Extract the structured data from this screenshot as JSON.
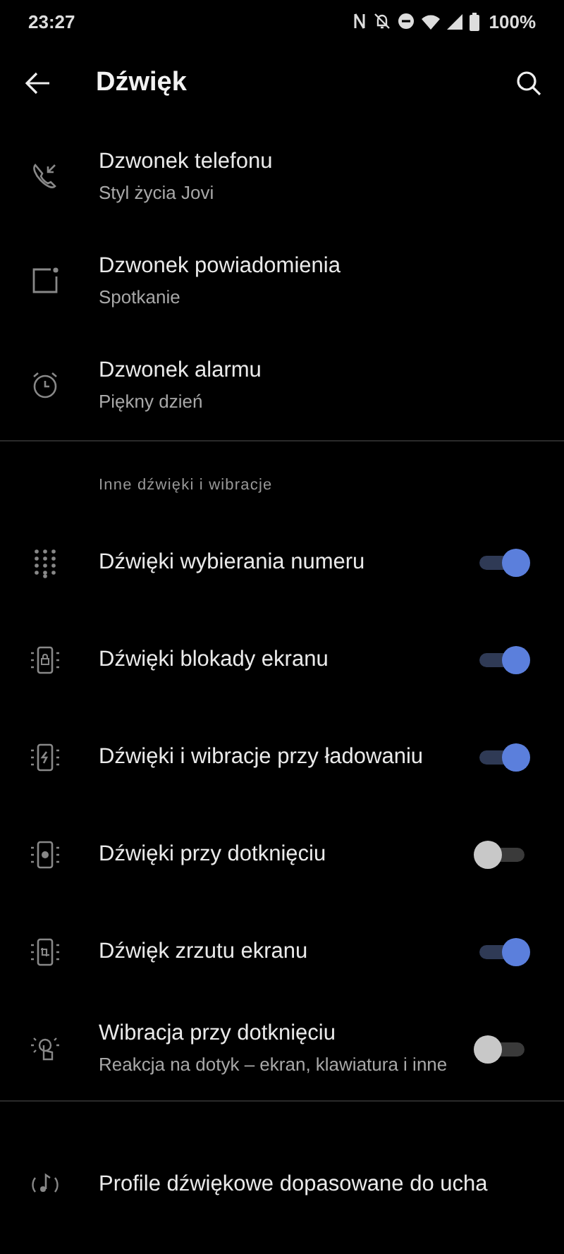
{
  "status_bar": {
    "time": "23:27",
    "battery": "100%"
  },
  "header": {
    "title": "Dźwięk"
  },
  "ringtones": [
    {
      "title": "Dzwonek telefonu",
      "subtitle": "Styl życia Jovi"
    },
    {
      "title": "Dzwonek powiadomienia",
      "subtitle": "Spotkanie"
    },
    {
      "title": "Dzwonek alarmu",
      "subtitle": "Piękny dzień"
    }
  ],
  "section": {
    "title": "Inne dźwięki i wibracje"
  },
  "toggles": [
    {
      "title": "Dźwięki wybierania numeru",
      "on": true
    },
    {
      "title": "Dźwięki blokady ekranu",
      "on": true
    },
    {
      "title": "Dźwięki i wibracje przy ładowaniu",
      "on": true
    },
    {
      "title": "Dźwięki przy dotknięciu",
      "on": false
    },
    {
      "title": "Dźwięk zrzutu ekranu",
      "on": true
    },
    {
      "title": "Wibracja przy dotknięciu",
      "subtitle": "Reakcja na dotyk – ekran, klawiatura i inne",
      "on": false
    }
  ],
  "bottom_item": {
    "title": "Profile dźwiękowe dopasowane do ucha"
  }
}
